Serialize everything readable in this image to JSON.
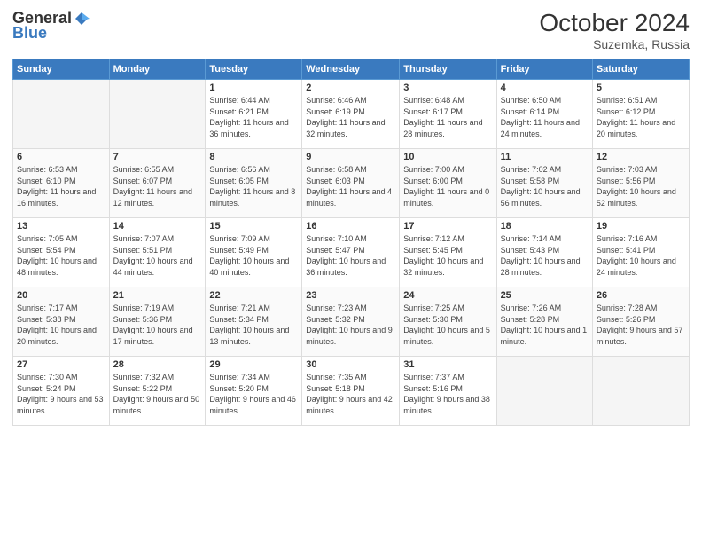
{
  "header": {
    "logo_general": "General",
    "logo_blue": "Blue",
    "month": "October 2024",
    "location": "Suzemka, Russia"
  },
  "days_of_week": [
    "Sunday",
    "Monday",
    "Tuesday",
    "Wednesday",
    "Thursday",
    "Friday",
    "Saturday"
  ],
  "weeks": [
    [
      {
        "day": "",
        "empty": true
      },
      {
        "day": "",
        "empty": true
      },
      {
        "day": "1",
        "sunrise": "Sunrise: 6:44 AM",
        "sunset": "Sunset: 6:21 PM",
        "daylight": "Daylight: 11 hours and 36 minutes."
      },
      {
        "day": "2",
        "sunrise": "Sunrise: 6:46 AM",
        "sunset": "Sunset: 6:19 PM",
        "daylight": "Daylight: 11 hours and 32 minutes."
      },
      {
        "day": "3",
        "sunrise": "Sunrise: 6:48 AM",
        "sunset": "Sunset: 6:17 PM",
        "daylight": "Daylight: 11 hours and 28 minutes."
      },
      {
        "day": "4",
        "sunrise": "Sunrise: 6:50 AM",
        "sunset": "Sunset: 6:14 PM",
        "daylight": "Daylight: 11 hours and 24 minutes."
      },
      {
        "day": "5",
        "sunrise": "Sunrise: 6:51 AM",
        "sunset": "Sunset: 6:12 PM",
        "daylight": "Daylight: 11 hours and 20 minutes."
      }
    ],
    [
      {
        "day": "6",
        "sunrise": "Sunrise: 6:53 AM",
        "sunset": "Sunset: 6:10 PM",
        "daylight": "Daylight: 11 hours and 16 minutes."
      },
      {
        "day": "7",
        "sunrise": "Sunrise: 6:55 AM",
        "sunset": "Sunset: 6:07 PM",
        "daylight": "Daylight: 11 hours and 12 minutes."
      },
      {
        "day": "8",
        "sunrise": "Sunrise: 6:56 AM",
        "sunset": "Sunset: 6:05 PM",
        "daylight": "Daylight: 11 hours and 8 minutes."
      },
      {
        "day": "9",
        "sunrise": "Sunrise: 6:58 AM",
        "sunset": "Sunset: 6:03 PM",
        "daylight": "Daylight: 11 hours and 4 minutes."
      },
      {
        "day": "10",
        "sunrise": "Sunrise: 7:00 AM",
        "sunset": "Sunset: 6:00 PM",
        "daylight": "Daylight: 11 hours and 0 minutes."
      },
      {
        "day": "11",
        "sunrise": "Sunrise: 7:02 AM",
        "sunset": "Sunset: 5:58 PM",
        "daylight": "Daylight: 10 hours and 56 minutes."
      },
      {
        "day": "12",
        "sunrise": "Sunrise: 7:03 AM",
        "sunset": "Sunset: 5:56 PM",
        "daylight": "Daylight: 10 hours and 52 minutes."
      }
    ],
    [
      {
        "day": "13",
        "sunrise": "Sunrise: 7:05 AM",
        "sunset": "Sunset: 5:54 PM",
        "daylight": "Daylight: 10 hours and 48 minutes."
      },
      {
        "day": "14",
        "sunrise": "Sunrise: 7:07 AM",
        "sunset": "Sunset: 5:51 PM",
        "daylight": "Daylight: 10 hours and 44 minutes."
      },
      {
        "day": "15",
        "sunrise": "Sunrise: 7:09 AM",
        "sunset": "Sunset: 5:49 PM",
        "daylight": "Daylight: 10 hours and 40 minutes."
      },
      {
        "day": "16",
        "sunrise": "Sunrise: 7:10 AM",
        "sunset": "Sunset: 5:47 PM",
        "daylight": "Daylight: 10 hours and 36 minutes."
      },
      {
        "day": "17",
        "sunrise": "Sunrise: 7:12 AM",
        "sunset": "Sunset: 5:45 PM",
        "daylight": "Daylight: 10 hours and 32 minutes."
      },
      {
        "day": "18",
        "sunrise": "Sunrise: 7:14 AM",
        "sunset": "Sunset: 5:43 PM",
        "daylight": "Daylight: 10 hours and 28 minutes."
      },
      {
        "day": "19",
        "sunrise": "Sunrise: 7:16 AM",
        "sunset": "Sunset: 5:41 PM",
        "daylight": "Daylight: 10 hours and 24 minutes."
      }
    ],
    [
      {
        "day": "20",
        "sunrise": "Sunrise: 7:17 AM",
        "sunset": "Sunset: 5:38 PM",
        "daylight": "Daylight: 10 hours and 20 minutes."
      },
      {
        "day": "21",
        "sunrise": "Sunrise: 7:19 AM",
        "sunset": "Sunset: 5:36 PM",
        "daylight": "Daylight: 10 hours and 17 minutes."
      },
      {
        "day": "22",
        "sunrise": "Sunrise: 7:21 AM",
        "sunset": "Sunset: 5:34 PM",
        "daylight": "Daylight: 10 hours and 13 minutes."
      },
      {
        "day": "23",
        "sunrise": "Sunrise: 7:23 AM",
        "sunset": "Sunset: 5:32 PM",
        "daylight": "Daylight: 10 hours and 9 minutes."
      },
      {
        "day": "24",
        "sunrise": "Sunrise: 7:25 AM",
        "sunset": "Sunset: 5:30 PM",
        "daylight": "Daylight: 10 hours and 5 minutes."
      },
      {
        "day": "25",
        "sunrise": "Sunrise: 7:26 AM",
        "sunset": "Sunset: 5:28 PM",
        "daylight": "Daylight: 10 hours and 1 minute."
      },
      {
        "day": "26",
        "sunrise": "Sunrise: 7:28 AM",
        "sunset": "Sunset: 5:26 PM",
        "daylight": "Daylight: 9 hours and 57 minutes."
      }
    ],
    [
      {
        "day": "27",
        "sunrise": "Sunrise: 7:30 AM",
        "sunset": "Sunset: 5:24 PM",
        "daylight": "Daylight: 9 hours and 53 minutes."
      },
      {
        "day": "28",
        "sunrise": "Sunrise: 7:32 AM",
        "sunset": "Sunset: 5:22 PM",
        "daylight": "Daylight: 9 hours and 50 minutes."
      },
      {
        "day": "29",
        "sunrise": "Sunrise: 7:34 AM",
        "sunset": "Sunset: 5:20 PM",
        "daylight": "Daylight: 9 hours and 46 minutes."
      },
      {
        "day": "30",
        "sunrise": "Sunrise: 7:35 AM",
        "sunset": "Sunset: 5:18 PM",
        "daylight": "Daylight: 9 hours and 42 minutes."
      },
      {
        "day": "31",
        "sunrise": "Sunrise: 7:37 AM",
        "sunset": "Sunset: 5:16 PM",
        "daylight": "Daylight: 9 hours and 38 minutes."
      },
      {
        "day": "",
        "empty": true
      },
      {
        "day": "",
        "empty": true
      }
    ]
  ]
}
